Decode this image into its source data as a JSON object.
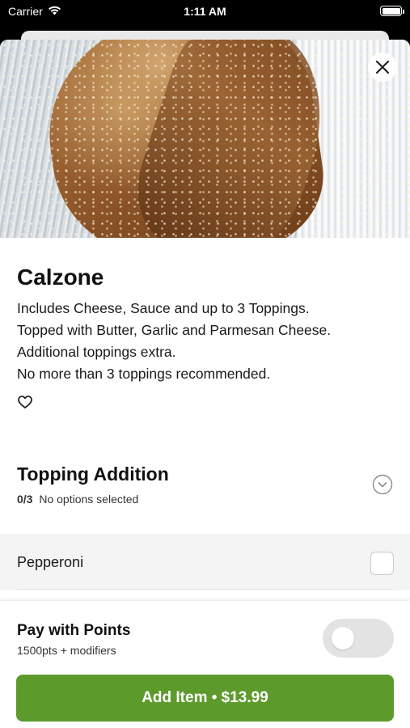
{
  "status_bar": {
    "carrier": "Carrier",
    "time": "1:11 AM",
    "wifi_icon": "wifi-icon",
    "battery_icon": "battery-icon"
  },
  "item": {
    "title": "Calzone",
    "description_lines": [
      "Includes Cheese, Sauce and up to 3 Toppings.",
      "Topped with Butter, Garlic and Parmesan Cheese.",
      "Additional toppings extra.",
      "No more than 3 toppings recommended."
    ],
    "favorite_icon": "heart-icon",
    "close_icon": "close-icon"
  },
  "modifier_group": {
    "title": "Topping Addition",
    "count": "0/3",
    "status": "No options selected",
    "expand_icon": "chevron-down-circle-icon",
    "options": [
      {
        "label": "Pepperoni",
        "checked": false
      }
    ]
  },
  "footer": {
    "points_title": "Pay with Points",
    "points_sub": "1500pts + modifiers",
    "points_toggle_on": false,
    "add_button_label": "Add Item • $13.99",
    "accent_color": "#5d9a2c"
  }
}
